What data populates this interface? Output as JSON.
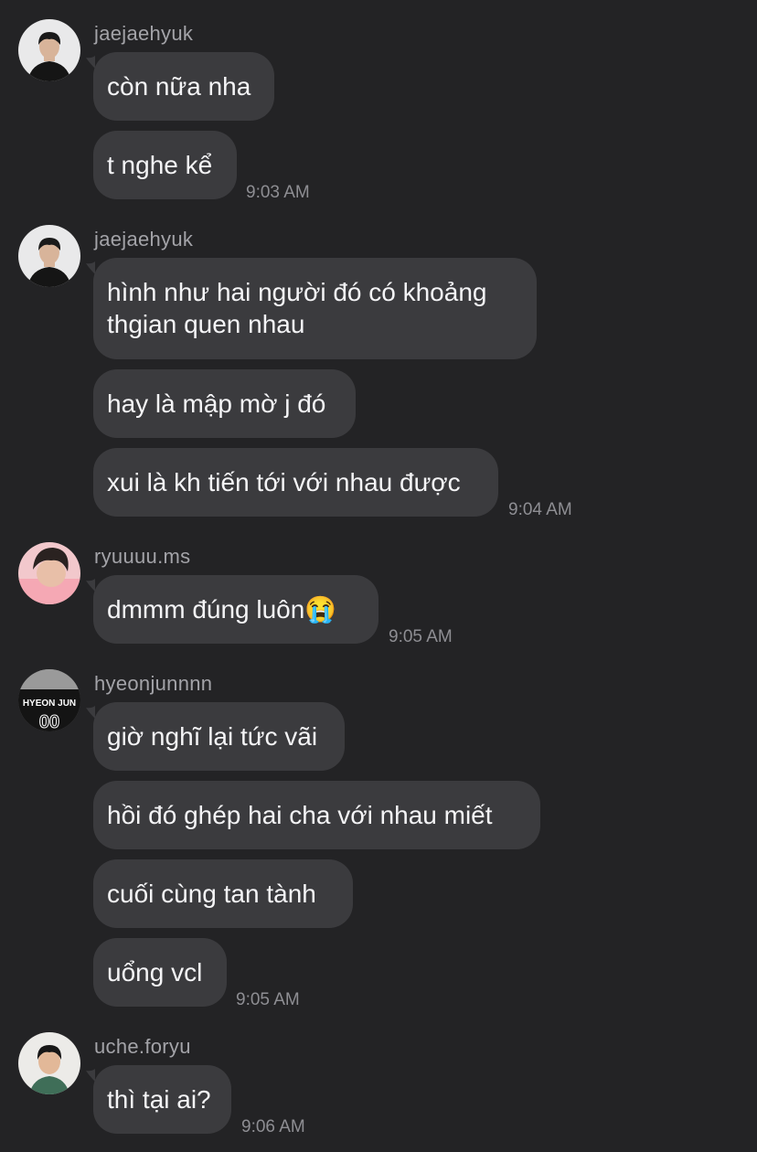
{
  "groups": [
    {
      "sender": "jaejaehyuk",
      "avatar_icon": "profile-photo-icon",
      "messages": [
        "còn nữa nha",
        "t nghe kể"
      ],
      "time": "9:03 AM"
    },
    {
      "sender": "jaejaehyuk",
      "avatar_icon": "profile-photo-icon",
      "messages": [
        "hình như hai người đó có khoảng thgian quen nhau",
        "hay là mập mờ j đó",
        "xui là kh tiến tới với nhau được"
      ],
      "time": "9:04 AM"
    },
    {
      "sender": "ryuuuu.ms",
      "avatar_icon": "profile-photo-icon",
      "messages": [
        "dmmm đúng luôn😭"
      ],
      "time": "9:05 AM"
    },
    {
      "sender": "hyeonjunnnn",
      "avatar_icon": "profile-photo-icon",
      "avatar_text": "HYEON JUN",
      "messages": [
        "giờ nghĩ lại tức vãi",
        "hồi đó ghép hai cha với nhau miết",
        "cuối cùng tan tành",
        "uổng vcl"
      ],
      "time": "9:05 AM"
    },
    {
      "sender": "uche.foryu",
      "avatar_icon": "profile-photo-icon",
      "messages": [
        "thì tại ai?"
      ],
      "time": "9:06 AM"
    }
  ]
}
